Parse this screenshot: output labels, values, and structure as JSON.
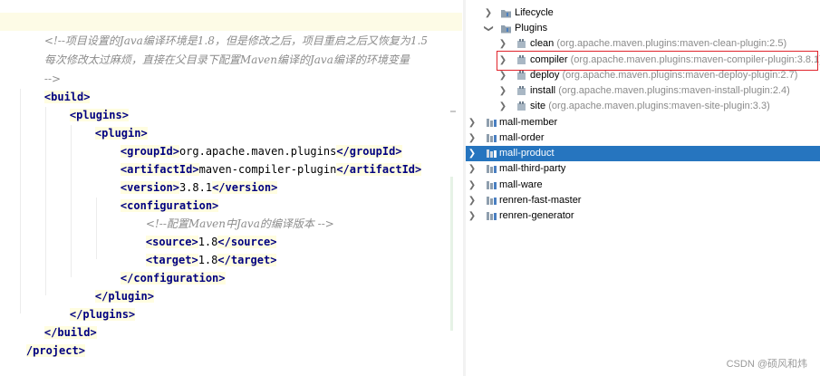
{
  "editor": {
    "comment_line1": "<!--项目设置的Java编译环境是1.8，但是修改之后，项目重启之后又恢复为1.5",
    "comment_line2": "每次修改太过麻烦，直接在父目录下配置Maven编译的Java编译的环境变量",
    "comment_end": "-->",
    "build_open": "<build>",
    "plugins_open": "<plugins>",
    "plugin_open": "<plugin>",
    "groupId_open": "<groupId>",
    "groupId_value": "org.apache.maven.plugins",
    "groupId_close": "</groupId>",
    "artifactId_open": "<artifactId>",
    "artifactId_value": "maven-compiler-plugin",
    "artifactId_close": "</artifactId>",
    "version_open": "<version>",
    "version_value": "3.8.1",
    "version_close": "</version>",
    "configuration_open": "<configuration>",
    "config_comment": "<!--配置Maven中Java的编译版本 -->",
    "source_open": "<source>",
    "source_value": "1.8",
    "source_close": "</source>",
    "target_open": "<target>",
    "target_value": "1.8",
    "target_close": "</target>",
    "configuration_close": "</configuration>",
    "plugin_close": "</plugin>",
    "plugins_close": "</plugins>",
    "build_close": "</build>",
    "project_close": "/project>"
  },
  "tree": {
    "lifecycle": "Lifecycle",
    "plugins": "Plugins",
    "plugin_items": [
      {
        "name": "clean",
        "meta": "(org.apache.maven.plugins:maven-clean-plugin:2.5)"
      },
      {
        "name": "compiler",
        "meta": "(org.apache.maven.plugins:maven-compiler-plugin:3.8.1)"
      },
      {
        "name": "deploy",
        "meta": "(org.apache.maven.plugins:maven-deploy-plugin:2.7)"
      },
      {
        "name": "install",
        "meta": "(org.apache.maven.plugins:maven-install-plugin:2.4)"
      },
      {
        "name": "site",
        "meta": "(org.apache.maven.plugins:maven-site-plugin:3.3)"
      }
    ],
    "modules": [
      {
        "name": "mall-member"
      },
      {
        "name": "mall-order"
      },
      {
        "name": "mall-product",
        "selected": true
      },
      {
        "name": "mall-third-party"
      },
      {
        "name": "mall-ware"
      },
      {
        "name": "renren-fast-master"
      },
      {
        "name": "renren-generator"
      }
    ],
    "icons": {
      "folder": "maven-folder-icon",
      "plugin": "maven-plugin-icon",
      "module": "maven-module-icon"
    }
  },
  "watermark": "CSDN @硕风和炜",
  "colors": {
    "selection": "#2675bf",
    "highlight_border": "#e0232b",
    "tag": "#000080",
    "comment": "#8c8c8c"
  }
}
